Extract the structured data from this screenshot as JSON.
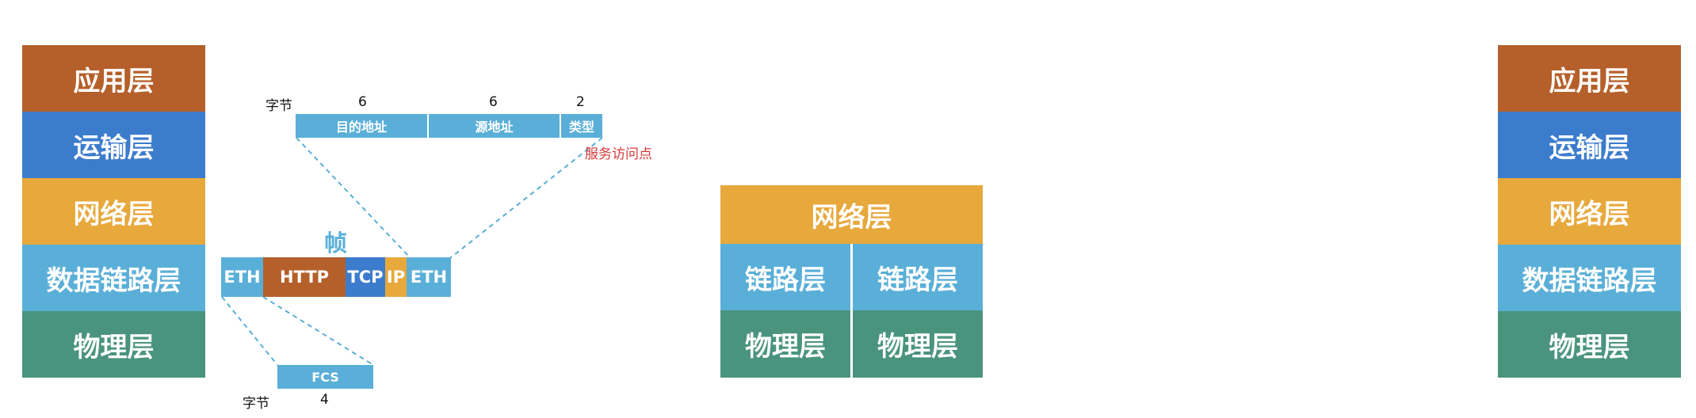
{
  "colors": {
    "application": "#b5602a",
    "transport": "#3c7ccd",
    "network": "#e7a83c",
    "datalink": "#5aafd8",
    "physical": "#4a947e",
    "annotation": "#d63a3a",
    "dashed": "#5aafd8"
  },
  "left_stack": [
    "应用层",
    "运输层",
    "网络层",
    "数据链路层",
    "物理层"
  ],
  "right_stack": [
    "应用层",
    "运输层",
    "网络层",
    "数据链路层",
    "物理层"
  ],
  "frame": {
    "title": "帧",
    "segments": [
      "ETH",
      "HTTP",
      "TCP",
      "IP",
      "ETH"
    ]
  },
  "header": {
    "unit_label": "字节",
    "sizes": [
      "6",
      "6",
      "2"
    ],
    "fields": [
      "目的地址",
      "源地址",
      "类型"
    ],
    "annotation": "服务访问点"
  },
  "trailer": {
    "unit_label": "字节",
    "size": "4",
    "field": "FCS"
  },
  "router": {
    "network": "网络层",
    "links": [
      "链路层",
      "链路层"
    ],
    "physicals": [
      "物理层",
      "物理层"
    ]
  }
}
